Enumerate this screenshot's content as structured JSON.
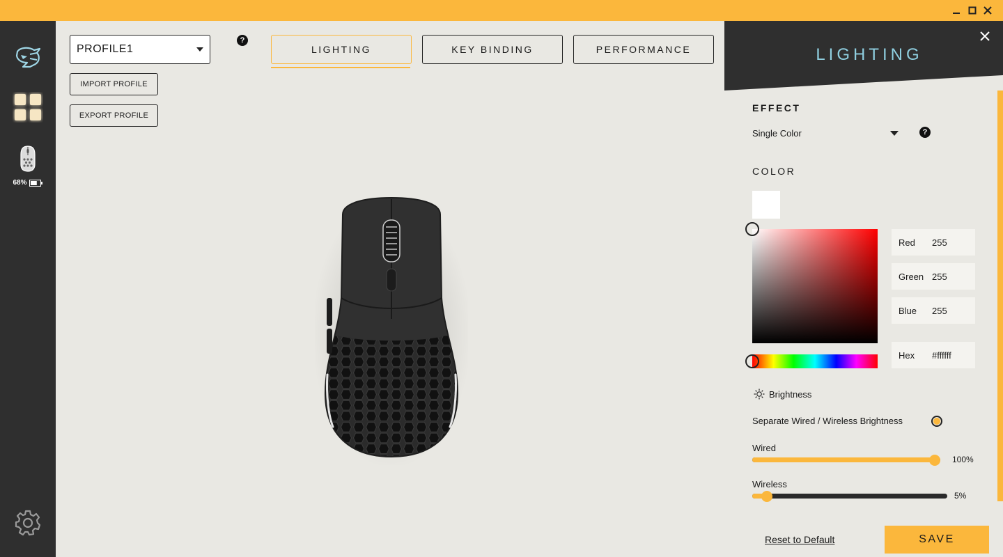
{
  "colors": {
    "accent": "#fbb73c",
    "rail_bg": "#2f2f2f",
    "main_bg": "#e9e8e3",
    "panel_title": "#8fcfe0",
    "selected_color": "#ffffff"
  },
  "window_controls": [
    "minimize-icon",
    "maximize-icon",
    "close-icon"
  ],
  "sidebar": {
    "items": [
      {
        "icon": "brand-logo-icon"
      },
      {
        "icon": "dashboard-grid-icon",
        "active": true
      },
      {
        "icon": "mouse-device-icon"
      }
    ],
    "battery": {
      "percent_label": "68%",
      "level": 0.68
    },
    "settings_icon": "gear-icon"
  },
  "profile": {
    "selected": "PROFILE1",
    "help": "?",
    "import_label": "IMPORT PROFILE",
    "export_label": "EXPORT PROFILE"
  },
  "tabs": [
    {
      "label": "LIGHTING",
      "active": true
    },
    {
      "label": "KEY BINDING",
      "active": false
    },
    {
      "label": "PERFORMANCE",
      "active": false
    }
  ],
  "panel": {
    "title": "LIGHTING",
    "effect_heading": "EFFECT",
    "effect_value": "Single Color",
    "effect_help": "?",
    "color_heading": "COLOR",
    "rgb": {
      "red_label": "Red",
      "red": "255",
      "green_label": "Green",
      "green": "255",
      "blue_label": "Blue",
      "blue": "255",
      "hex_label": "Hex",
      "hex": "#ffffff"
    },
    "brightness_label": "Brightness",
    "separate_label": "Separate Wired / Wireless Brightness",
    "separate_enabled": true,
    "wired_label": "Wired",
    "wired_value": "100%",
    "wired_level": 1.0,
    "wireless_label": "Wireless",
    "wireless_value": "5%",
    "wireless_level": 0.05,
    "reset_label": "Reset to Default",
    "save_label": "SAVE"
  }
}
